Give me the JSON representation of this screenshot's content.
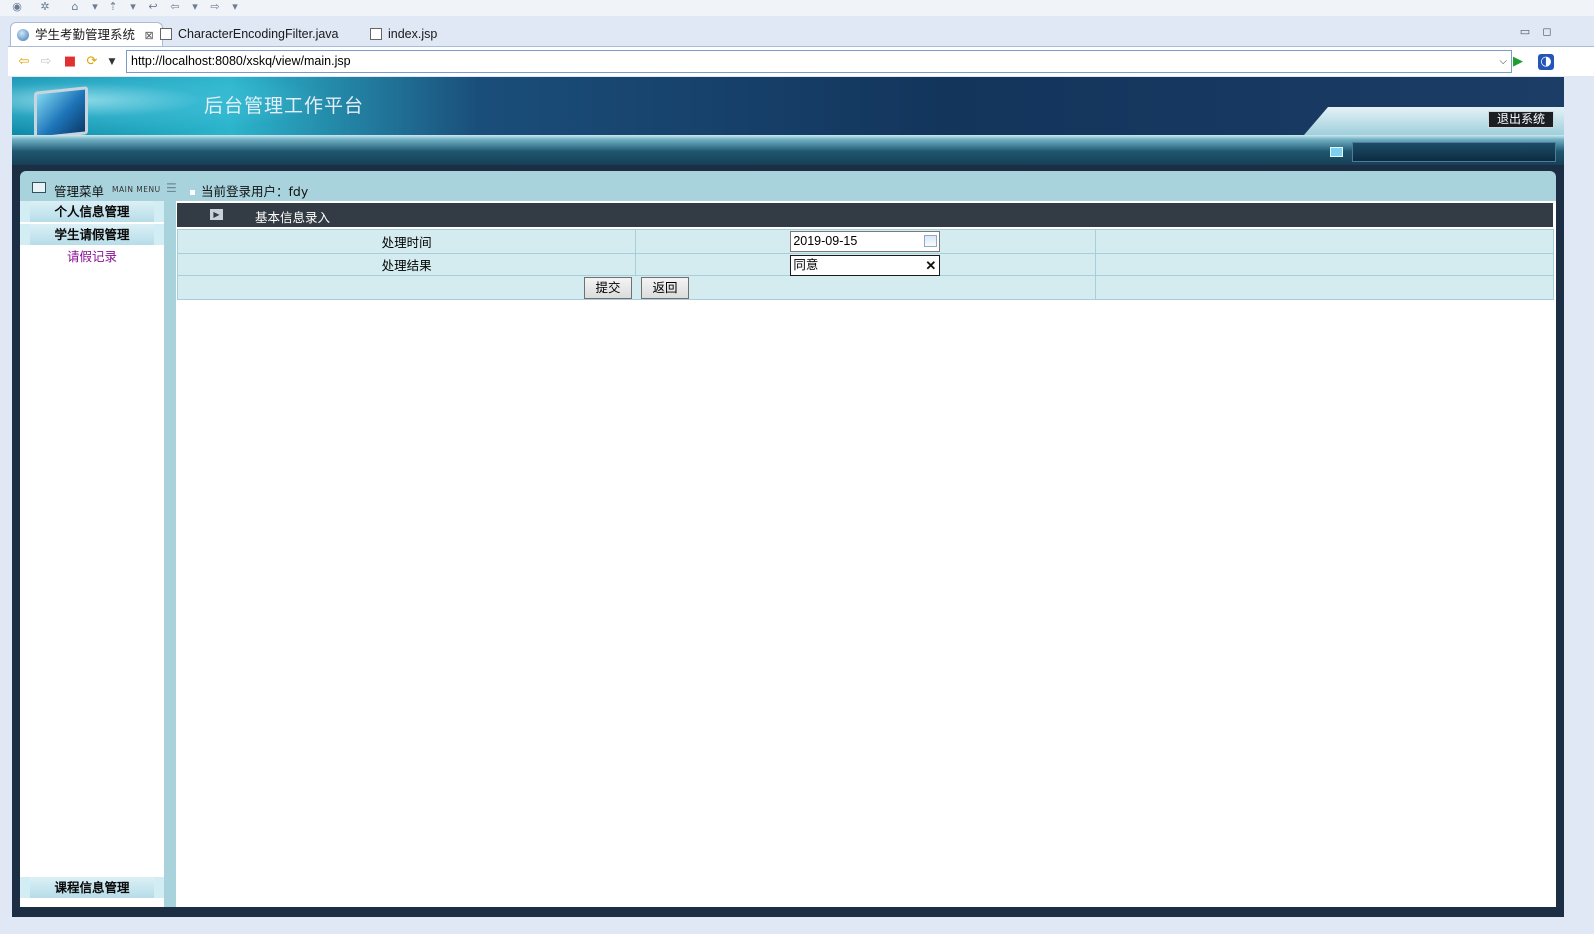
{
  "tabs": [
    {
      "label": "学生考勤管理系统",
      "close": "⊠"
    },
    {
      "label": "CharacterEncodingFilter.java"
    },
    {
      "label": "index.jsp"
    }
  ],
  "address": {
    "url": "http://localhost:8080/xskq/view/main.jsp"
  },
  "header": {
    "title": "后台管理工作平台",
    "logout_label": "退出系统"
  },
  "sidebar": {
    "title": "管理菜单",
    "subtitle": "MAIN MENU",
    "groups": [
      {
        "label": "个人信息管理"
      },
      {
        "label": "学生请假管理"
      },
      {
        "label": "课程信息管理"
      }
    ],
    "links": [
      {
        "label": "请假记录"
      }
    ]
  },
  "userbar": {
    "label": "当前登录用户：fdy"
  },
  "form": {
    "section_title": "基本信息录入",
    "rows": [
      {
        "label": "处理时间",
        "value": "2019-09-15"
      },
      {
        "label": "处理结果",
        "value": "同意"
      }
    ],
    "submit_label": "提交",
    "back_label": "返回"
  },
  "colors": {
    "banner": "#13355c",
    "content_bg": "#a9d3dc",
    "form_cell": "#d4ebf0",
    "form_header": "#333c44",
    "link": "#8a0f96"
  }
}
